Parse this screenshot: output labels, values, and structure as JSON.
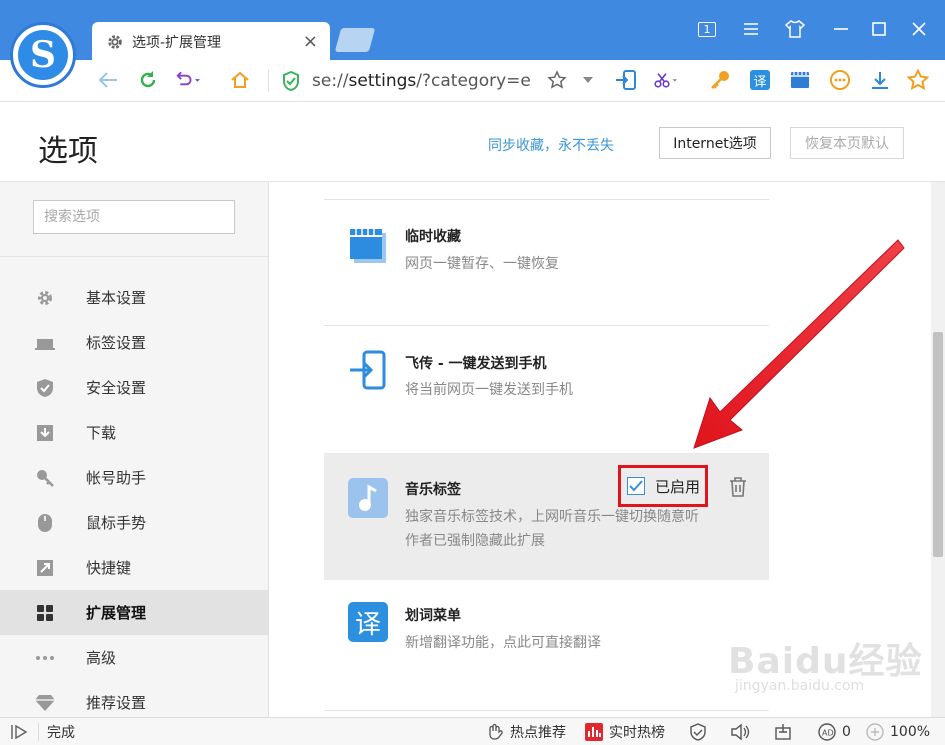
{
  "tab": {
    "title": "选项-扩展管理",
    "close_icon": "×"
  },
  "toolbar": {
    "url_scheme": "se://",
    "url_host": "settings",
    "url_rest": "/?category=e"
  },
  "window": {
    "page_count": "1"
  },
  "header": {
    "title": "选项",
    "sync_link": "同步收藏，永不丢失",
    "internet_button": "Internet选项",
    "restore_button": "恢复本页默认"
  },
  "sidebar": {
    "search_placeholder": "搜索选项",
    "items": [
      {
        "label": "基本设置",
        "icon": "gear-icon"
      },
      {
        "label": "标签设置",
        "icon": "tab-icon"
      },
      {
        "label": "安全设置",
        "icon": "shield-icon"
      },
      {
        "label": "下载",
        "icon": "download-icon"
      },
      {
        "label": "帐号助手",
        "icon": "key-icon"
      },
      {
        "label": "鼠标手势",
        "icon": "mouse-icon"
      },
      {
        "label": "快捷键",
        "icon": "shortcut-icon"
      },
      {
        "label": "扩展管理",
        "icon": "extensions-icon",
        "active": true
      },
      {
        "label": "高级",
        "icon": "more-icon"
      },
      {
        "label": "推荐设置",
        "icon": "diamond-icon"
      }
    ]
  },
  "extensions": [
    {
      "name": "临时收藏",
      "desc": "网页一键暂存、一键恢复"
    },
    {
      "name": "飞传 - 一键发送到手机",
      "desc": "将当前网页一键发送到手机"
    },
    {
      "name": "音乐标签",
      "desc": "独家音乐标签技术，上网听音乐一键切换随意听",
      "note": "作者已强制隐藏此扩展",
      "enabled_label": "已启用",
      "enabled": true
    },
    {
      "name": "划词菜单",
      "desc": "新增翻译功能，点此可直接翻译",
      "icon_char": "译"
    }
  ],
  "status": {
    "done": "完成",
    "hot_recommend": "热点推荐",
    "realtime_hot": "实时热榜",
    "ad_count": "0",
    "zoom": "100%"
  },
  "watermark": {
    "brand": "Baidu经验",
    "url": "jingyan.baidu.com"
  },
  "colors": {
    "titlebar": "#3f8ae0",
    "accent": "#3a96d8",
    "highlight_box": "#e0141d",
    "arrow": "#e0141d"
  }
}
